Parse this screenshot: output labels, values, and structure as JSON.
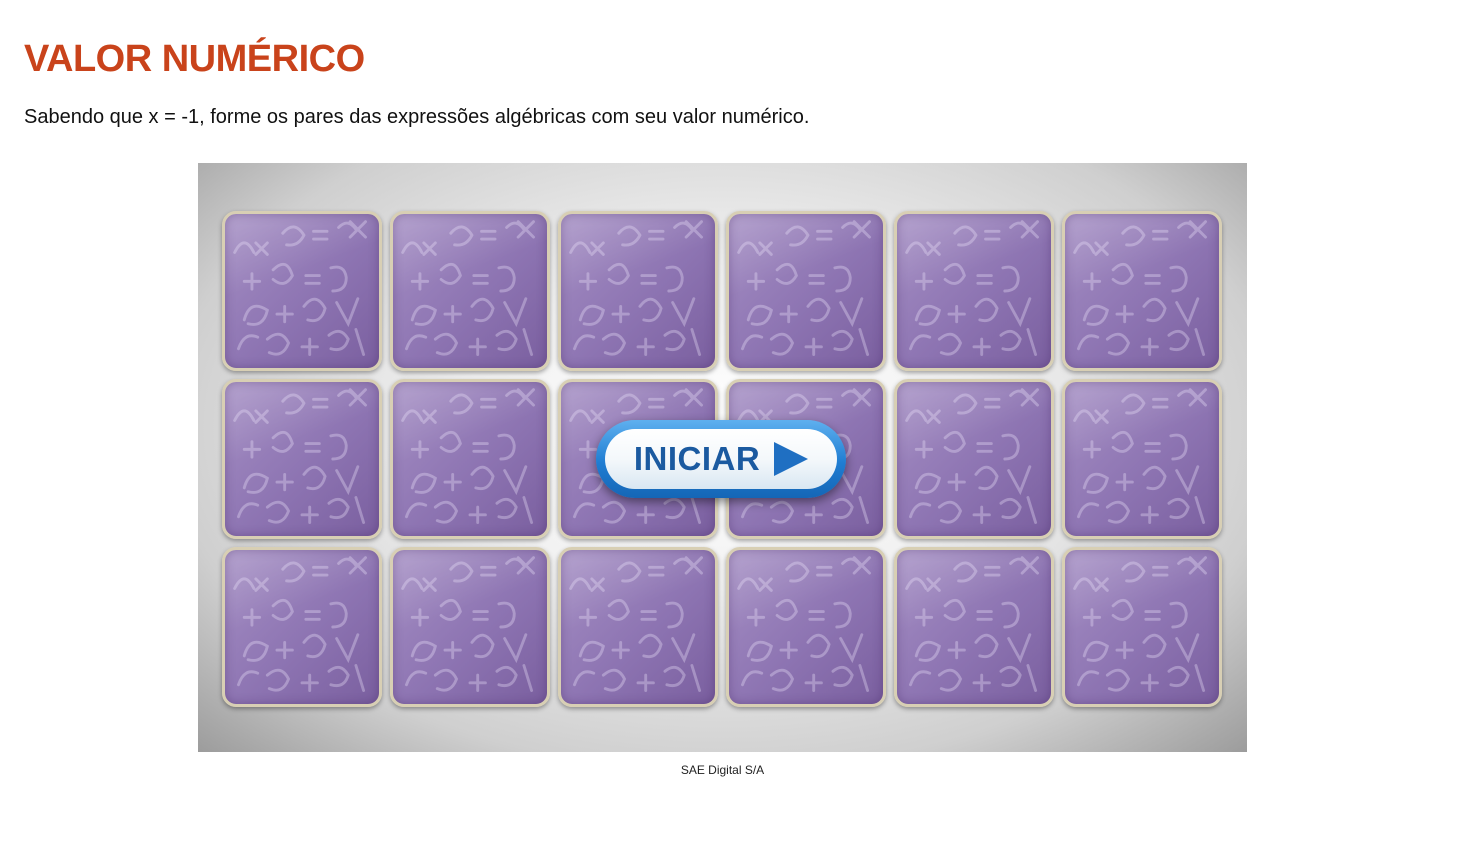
{
  "header": {
    "title": "VALOR NUMÉRICO",
    "instructions": "Sabendo que x = -1, forme os pares das expressões algébricas com seu valor numérico."
  },
  "game": {
    "start_button_label": "INICIAR",
    "start_icon": "play-triangle-icon",
    "card_back_pattern": "algebraic-formulas",
    "card_rows": 3,
    "card_columns": 6,
    "card_count": 18
  },
  "footer": {
    "credit": "SAE Digital S/A"
  },
  "colors": {
    "title": "#c9431b",
    "card_back": "#8d74b2",
    "card_border": "#d8cfb4",
    "button_blue": "#1f7dd2",
    "button_text": "#1b5aa0"
  }
}
